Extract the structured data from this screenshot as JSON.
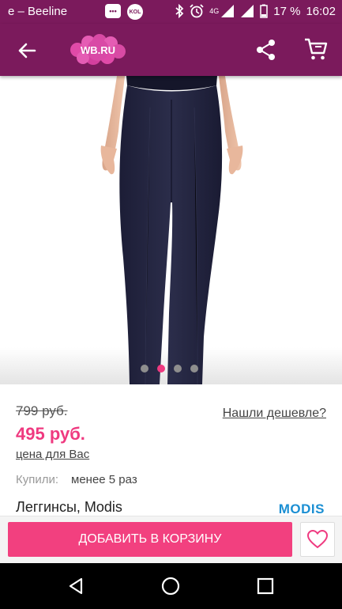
{
  "status_bar": {
    "carrier": "e – Beeline",
    "notif_box_text": "•••",
    "notif_circle_text": "KOL",
    "network": "4G",
    "battery": "17 %",
    "time": "16:02"
  },
  "app_bar": {
    "logo_text": "WB.RU"
  },
  "product": {
    "old_price": "799 руб.",
    "price": "495 руб.",
    "price_note": "цена для Вас",
    "cheaper_link": "Нашли дешевле?",
    "bought_label": "Купили:",
    "bought_value": "менее 5 раз",
    "title": "Леггинсы, Modis",
    "brand": "MODIS"
  },
  "carousel": {
    "count": 4,
    "active_index": 1
  },
  "actions": {
    "add_to_cart_label": "ДОБАВИТЬ В КОРЗИНУ"
  },
  "colors": {
    "brand_purple": "#7b1a5c",
    "accent_pink": "#ef3a80",
    "button_pink": "#f2407f",
    "brand_blue": "#1b8fd3"
  },
  "icons": [
    "back-arrow-icon",
    "share-icon",
    "cart-icon",
    "heart-icon",
    "bluetooth-icon",
    "alarm-icon",
    "signal-icon",
    "battery-icon",
    "nav-back-icon",
    "nav-home-icon",
    "nav-recents-icon"
  ]
}
